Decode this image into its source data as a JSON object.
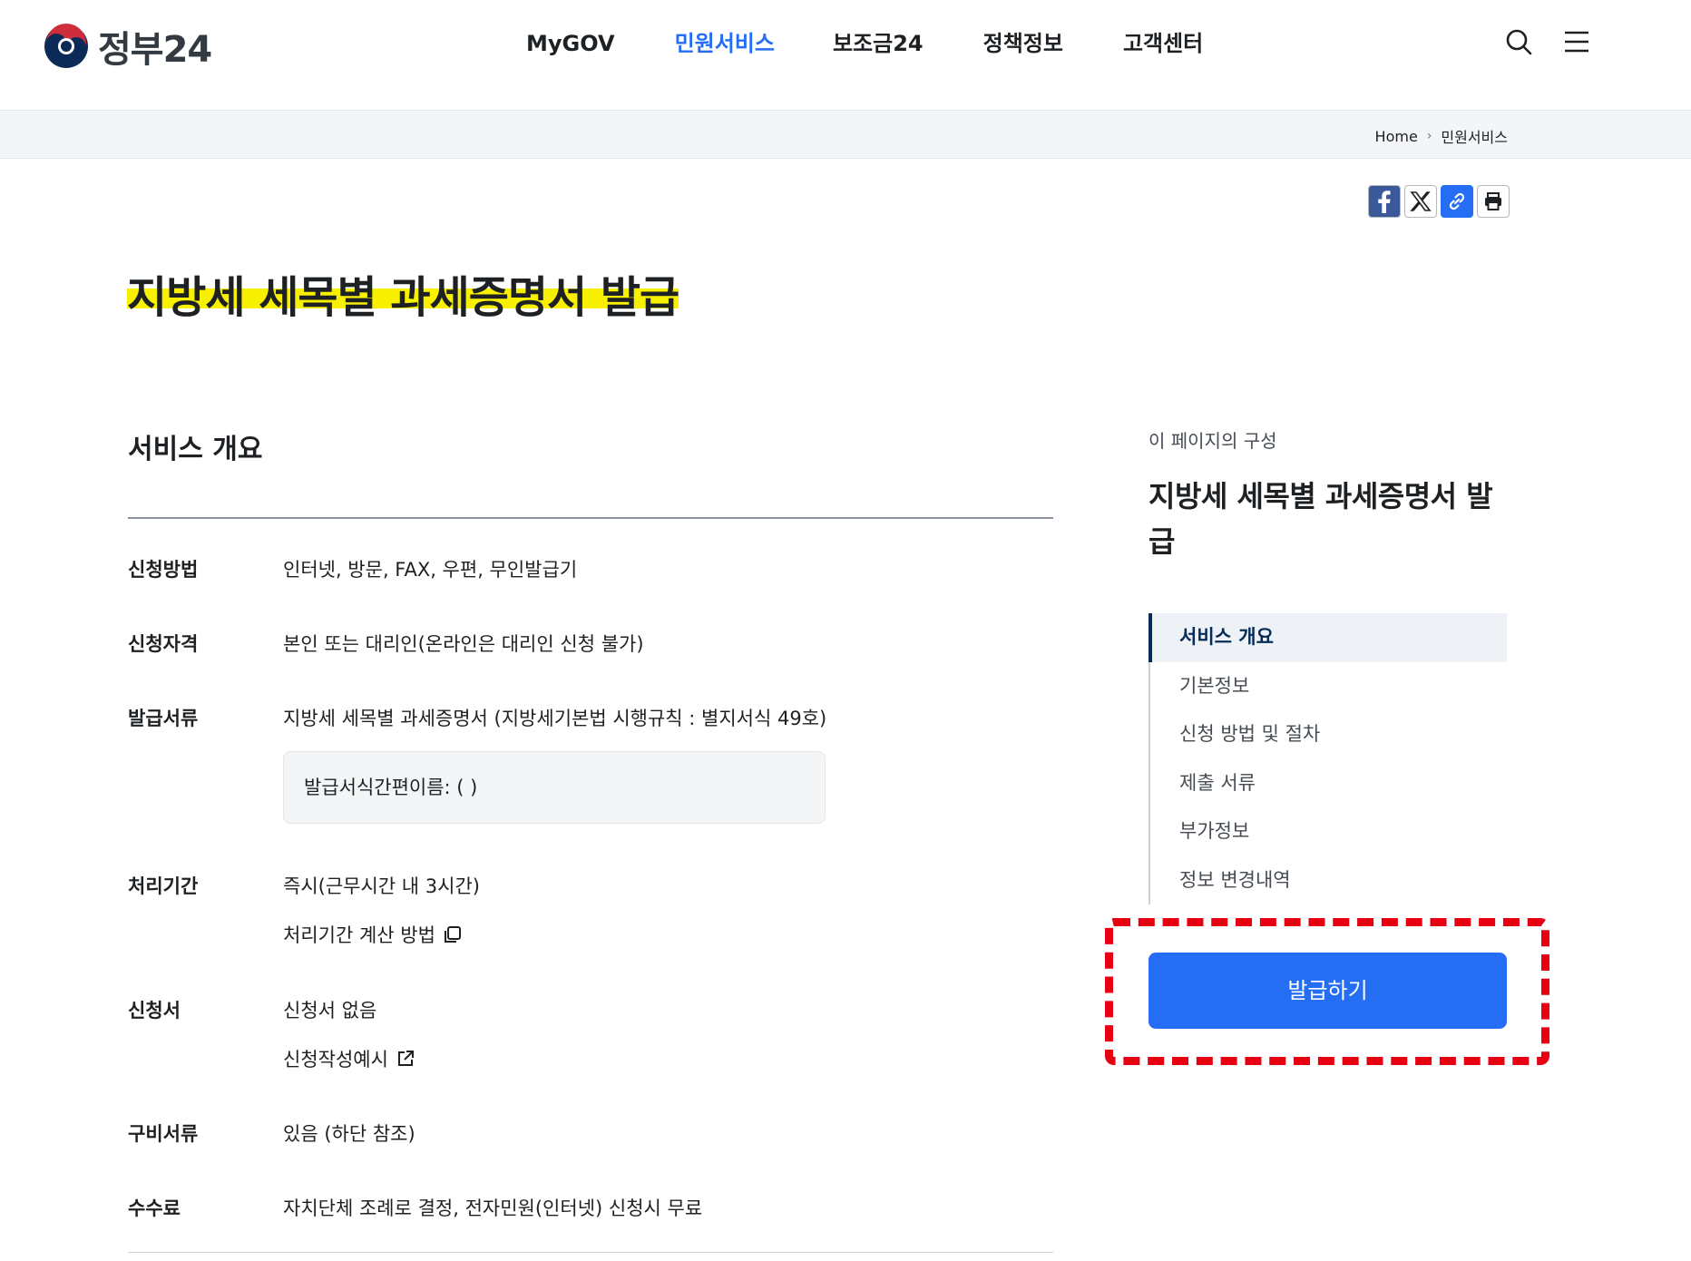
{
  "header": {
    "logo_text": "정부24",
    "nav": [
      "MyGOV",
      "민원서비스",
      "보조금24",
      "정책정보",
      "고객센터"
    ],
    "active_nav": "민원서비스"
  },
  "breadcrumb": {
    "home": "Home",
    "current": "민원서비스"
  },
  "share": {
    "icons": [
      "facebook-icon",
      "x-icon",
      "link-icon",
      "print-icon"
    ]
  },
  "page": {
    "title": "지방세 세목별 과세증명서 발급"
  },
  "overview": {
    "title": "서비스 개요",
    "rows": {
      "method_label": "신청방법",
      "method_value": "인터넷, 방문, FAX, 우편, 무인발급기",
      "eligibility_label": "신청자격",
      "eligibility_value": "본인 또는 대리인(온라인은 대리인 신청 불가)",
      "document_label": "발급서류",
      "document_value": "지방세 세목별 과세증명서 (지방세기본법 시행규칙 : 별지서식 49호)",
      "form_name": "발급서식간편이름: ( )",
      "period_label": "처리기간",
      "period_value": "즉시(근무시간 내 3시간)",
      "period_link": "처리기간 계산 방법",
      "application_label": "신청서",
      "application_value": "신청서 없음",
      "application_link": "신청작성예시",
      "required_label": "구비서류",
      "required_value": "있음 (하단 참조)",
      "fee_label": "수수료",
      "fee_value": "자치단체 조례로 결정, 전자민원(인터넷) 신청시 무료"
    }
  },
  "toc": {
    "caption": "이 페이지의 구성",
    "title": "지방세 세목별 과세증명서 발급",
    "items": [
      "서비스 개요",
      "기본정보",
      "신청 방법 및 절차",
      "제출 서류",
      "부가정보",
      "정보 변경내역"
    ],
    "active": "서비스 개요"
  },
  "action": {
    "issue_label": "발급하기"
  },
  "colors": {
    "primary": "#256ef4",
    "highlight": "#f7f000",
    "annotation": "#e60012",
    "navy": "#052b57"
  }
}
